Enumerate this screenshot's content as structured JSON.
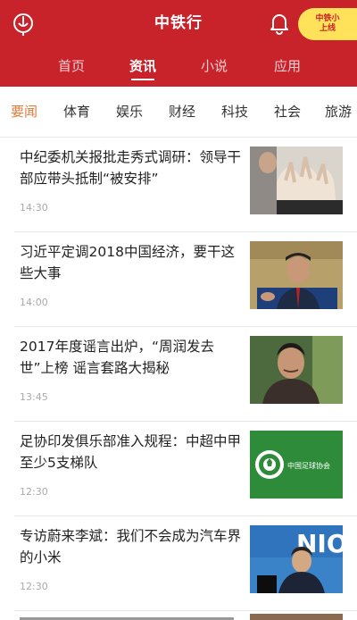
{
  "header": {
    "title": "中铁行",
    "badge_line1": "中铁小",
    "badge_line2": "上线",
    "tabs": [
      {
        "label": "首页"
      },
      {
        "label": "资讯"
      },
      {
        "label": "小说"
      },
      {
        "label": "应用"
      }
    ],
    "active_tab": "资讯"
  },
  "categories": [
    {
      "label": "要闻"
    },
    {
      "label": "体育"
    },
    {
      "label": "娱乐"
    },
    {
      "label": "财经"
    },
    {
      "label": "科技"
    },
    {
      "label": "社会"
    },
    {
      "label": "旅游"
    }
  ],
  "active_category": "要闻",
  "feed": [
    {
      "title": "中纪委机关报批走秀式调研：领导干部应带头抵制“被安排”",
      "time": "14:30"
    },
    {
      "title": "习近平定调2018中国经济，要干这些大事",
      "time": "14:00"
    },
    {
      "title": "2017年度谣言出炉，“周润发去世”上榜 谣言套路大揭秘",
      "time": "13:45"
    },
    {
      "title": "足协印发俱乐部准入规程：中超中甲至少5支梯队",
      "time": "12:30"
    },
    {
      "title": "专访蔚来李斌：我们不会成为汽车界的小米",
      "time": "12:30"
    }
  ],
  "thumb_text": {
    "cfa_label": "中国足球协会",
    "nio_label": "NIO"
  },
  "colors": {
    "brand_red": "#c8232b",
    "active_category": "#e07a3a",
    "badge_yellow": "#ffe25a"
  }
}
